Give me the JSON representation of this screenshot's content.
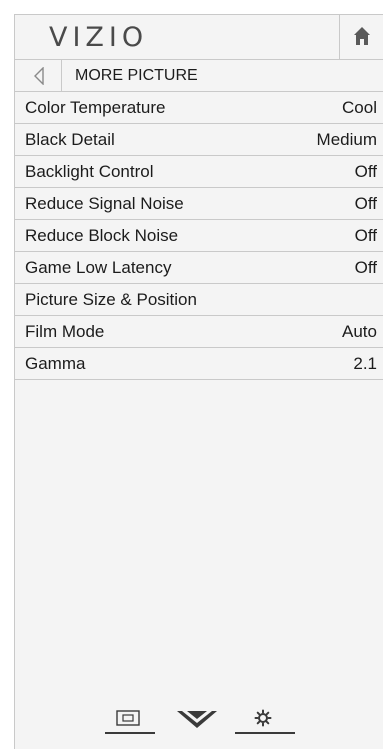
{
  "header": {
    "logo_text": "VIZIO",
    "home_icon": "home-icon"
  },
  "subheader": {
    "back_icon": "back-arrow-icon",
    "title": "MORE PICTURE"
  },
  "menu": {
    "items": [
      {
        "label": "Color Temperature",
        "value": "Cool"
      },
      {
        "label": "Black Detail",
        "value": "Medium"
      },
      {
        "label": "Backlight Control",
        "value": "Off"
      },
      {
        "label": "Reduce Signal Noise",
        "value": "Off"
      },
      {
        "label": "Reduce Block Noise",
        "value": "Off"
      },
      {
        "label": "Game Low Latency",
        "value": "Off"
      },
      {
        "label": "Picture Size & Position",
        "value": ""
      },
      {
        "label": "Film Mode",
        "value": "Auto"
      },
      {
        "label": "Gamma",
        "value": "2.1"
      }
    ]
  },
  "bottom_bar": {
    "tabs": [
      {
        "icon": "input-icon"
      },
      {
        "icon": "vizio-v-icon"
      },
      {
        "icon": "settings-gear-icon"
      }
    ]
  },
  "colors": {
    "panel_bg": "#f4f4f4",
    "border": "#c9c9c9",
    "text": "#1c1c1c"
  }
}
